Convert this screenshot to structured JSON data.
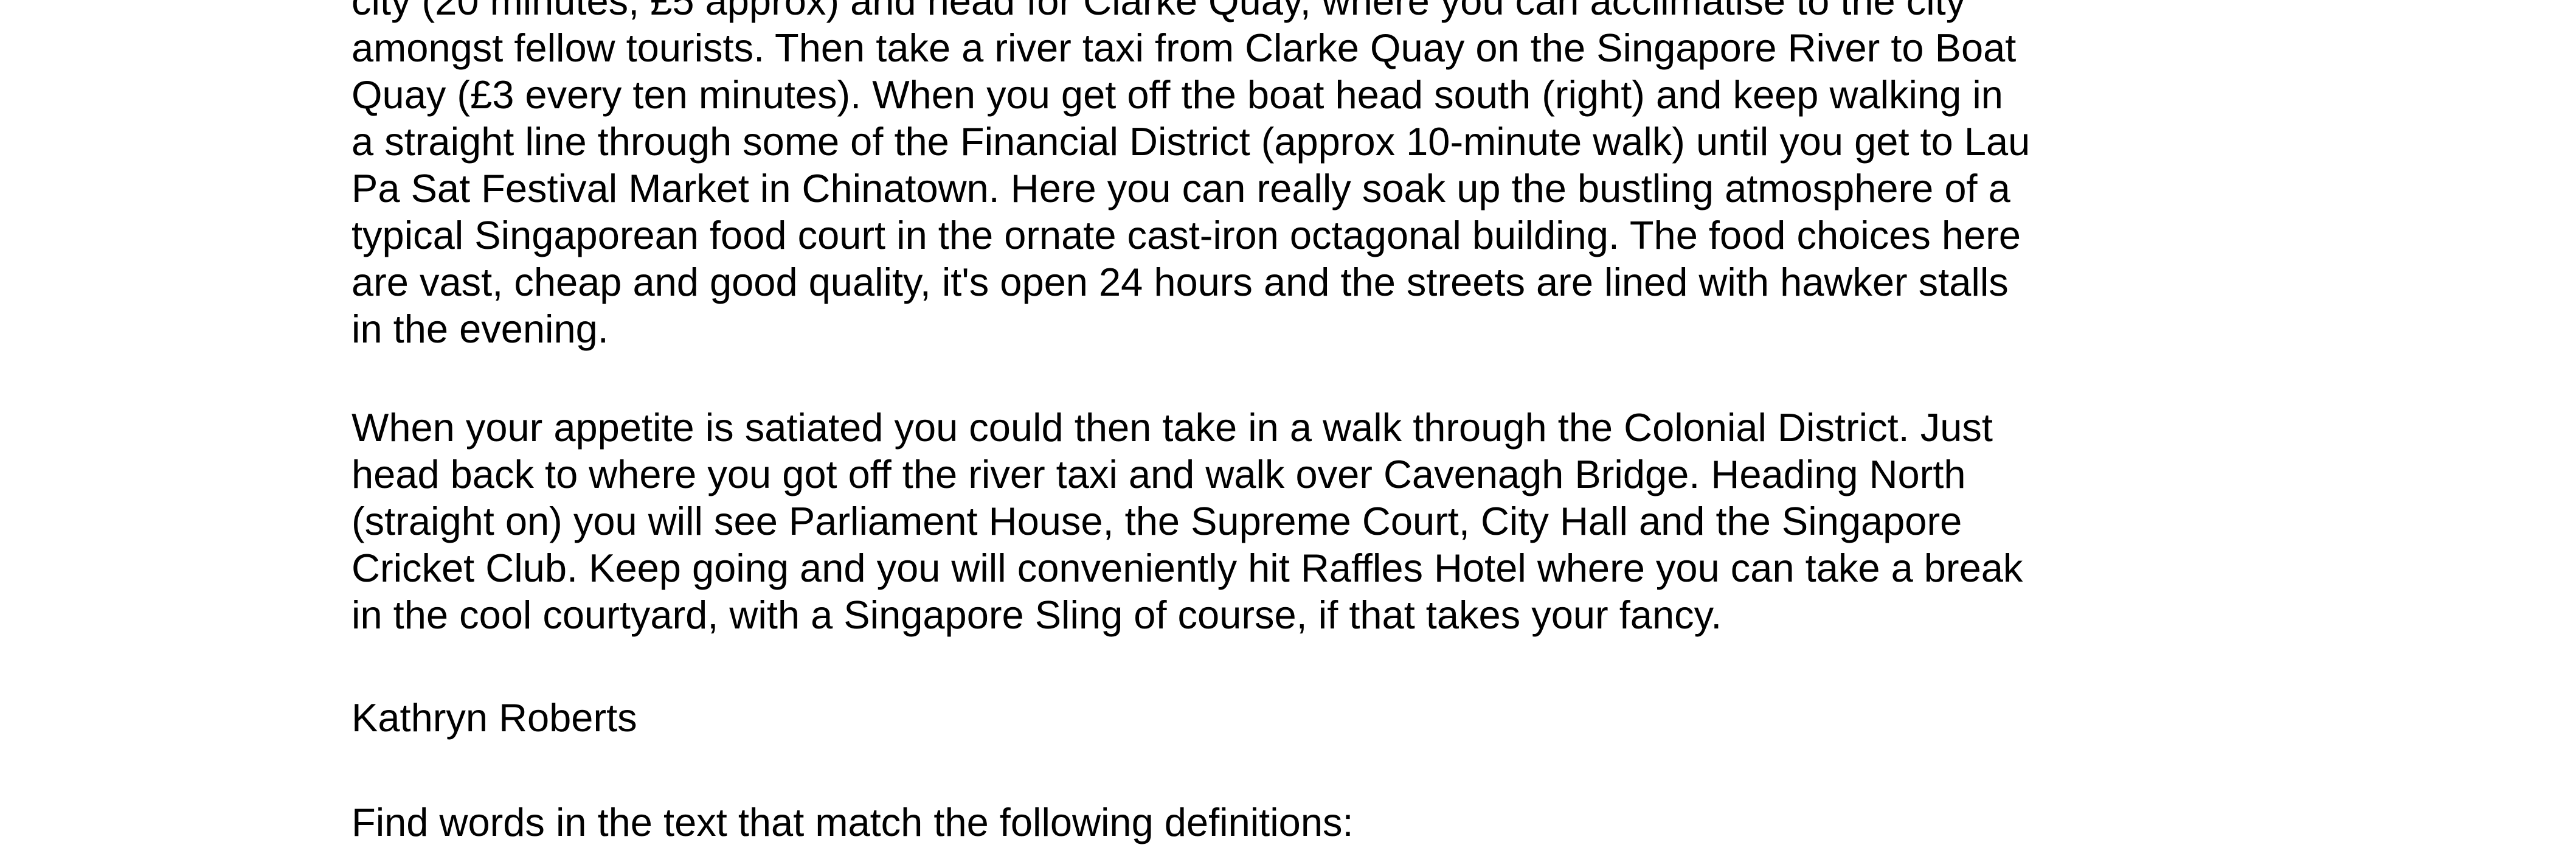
{
  "document": {
    "paragraph_1_lines": [
      "city (20 minutes, £5 approx) and head for Clarke Quay, where you can acclimatise to the city",
      "amongst fellow tourists. Then take a river taxi from Clarke Quay on the Singapore River to Boat",
      "Quay (£3 every ten minutes). When you get off the boat head south (right) and keep walking in",
      "a straight line through some of the Financial District (approx 10-minute walk) until you get to Lau",
      "Pa Sat Festival Market in Chinatown. Here you can really soak up the bustling atmosphere of a",
      "typical Singaporean food court in the ornate cast-iron octagonal building. The food choices here",
      "are vast, cheap and good quality, it's open 24 hours and the streets are lined with hawker stalls",
      "in the evening."
    ],
    "paragraph_2_lines": [
      "When your appetite is satiated you could then take in a walk through the Colonial District. Just",
      "head back to where you got off the river taxi and walk over Cavenagh Bridge. Heading North",
      "(straight on) you will see Parliament House, the Supreme Court, City Hall and the Singapore",
      "Cricket Club. Keep going and you will conveniently hit Raffles Hotel where you can take a break",
      "in the cool courtyard, with a Singapore Sling of course, if that takes your fancy."
    ],
    "author": "Kathryn Roberts",
    "instruction": "Find words in the text that match the following definitions:"
  }
}
